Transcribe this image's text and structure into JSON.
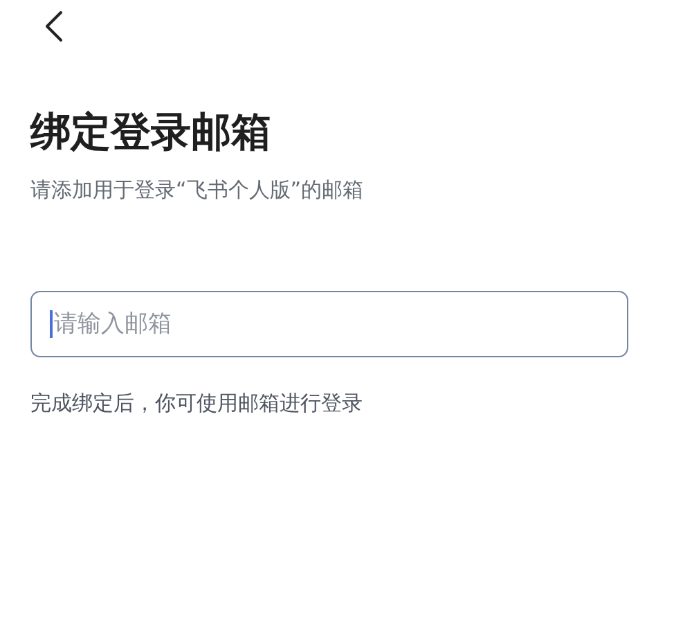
{
  "title": "绑定登录邮箱",
  "subtitle": "请添加用于登录“飞书个人版”的邮箱",
  "email_field": {
    "placeholder": "请输入邮箱",
    "focused": true
  },
  "hint": "完成绑定后，你可使用邮箱进行登录"
}
